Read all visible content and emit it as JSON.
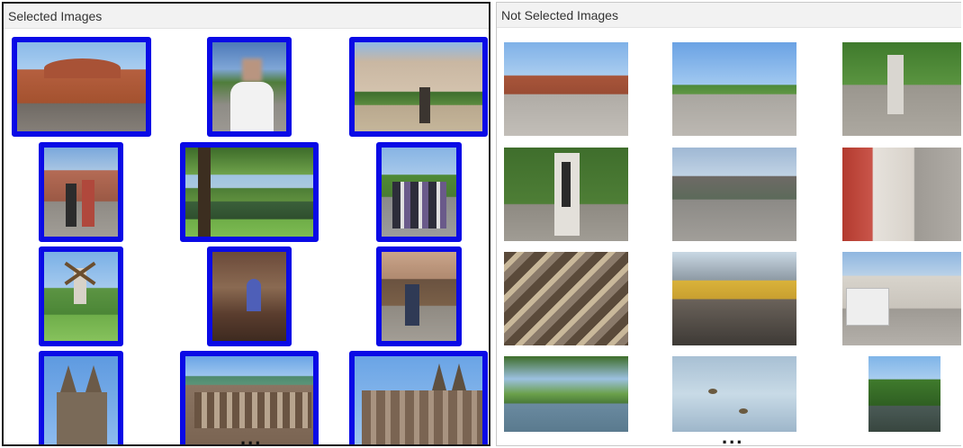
{
  "left_panel": {
    "title": "Selected Images",
    "more_indicator": "...",
    "images": [
      {
        "name": "station-facade-image",
        "scene": "brick train station facade with cars",
        "selected": true
      },
      {
        "name": "man-portrait-image",
        "scene": "man in white shirt in plaza (face blurred)",
        "selected": true
      },
      {
        "name": "market-square-statue-image",
        "scene": "market square with statue and cafe",
        "selected": true
      },
      {
        "name": "couple-street-image",
        "scene": "couple posing on old street",
        "selected": true
      },
      {
        "name": "park-pond-image",
        "scene": "park pond with trees",
        "selected": true
      },
      {
        "name": "family-group-image",
        "scene": "group of people by railing",
        "selected": true
      },
      {
        "name": "windmill-image",
        "scene": "windmill in park",
        "selected": true
      },
      {
        "name": "cathedral-interior-image",
        "scene": "gothic church interior",
        "selected": true
      },
      {
        "name": "musicians-statue-image",
        "scene": "person at Town Musicians statue",
        "selected": true
      },
      {
        "name": "cathedral-spires-image",
        "scene": "cathedral twin spires",
        "selected": true
      },
      {
        "name": "town-hall-image",
        "scene": "town hall facade",
        "selected": true
      },
      {
        "name": "cathedral-town-hall-image",
        "scene": "cathedral and town hall",
        "selected": true
      }
    ]
  },
  "right_panel": {
    "title": "Not Selected Images",
    "more_indicator": "...",
    "images": [
      {
        "name": "station-square-image",
        "scene": "station square with pedestrians",
        "selected": false
      },
      {
        "name": "wide-plaza-image",
        "scene": "wide plaza under blue sky",
        "selected": false
      },
      {
        "name": "sculpture-plaza-image",
        "scene": "sculpture in tree-lined plaza",
        "selected": false
      },
      {
        "name": "sculpture-closeup-image",
        "scene": "sculpture closeup",
        "selected": false
      },
      {
        "name": "tram-street-image",
        "scene": "street with tram and cyclist",
        "selected": false
      },
      {
        "name": "shopping-street-image",
        "scene": "shopping street",
        "selected": false
      },
      {
        "name": "shop-window-image",
        "scene": "shop window with crafts",
        "selected": false
      },
      {
        "name": "reflection-window-image",
        "scene": "reflections in shop window",
        "selected": false
      },
      {
        "name": "bus-street-image",
        "scene": "street with bus",
        "selected": false
      },
      {
        "name": "riverside-park-image",
        "scene": "riverside park",
        "selected": false
      },
      {
        "name": "ducks-water-image",
        "scene": "ducks on water",
        "selected": false
      },
      {
        "name": "small-pond-image",
        "scene": "small pond with trees",
        "selected": false
      }
    ]
  },
  "colors": {
    "selection_border": "#0a0ae6",
    "header_bg": "#f2f2f2",
    "sky": "#7fb1e3",
    "brick": "#a8553a",
    "green": "#3f7a2c",
    "stone": "#b8b3aa"
  }
}
